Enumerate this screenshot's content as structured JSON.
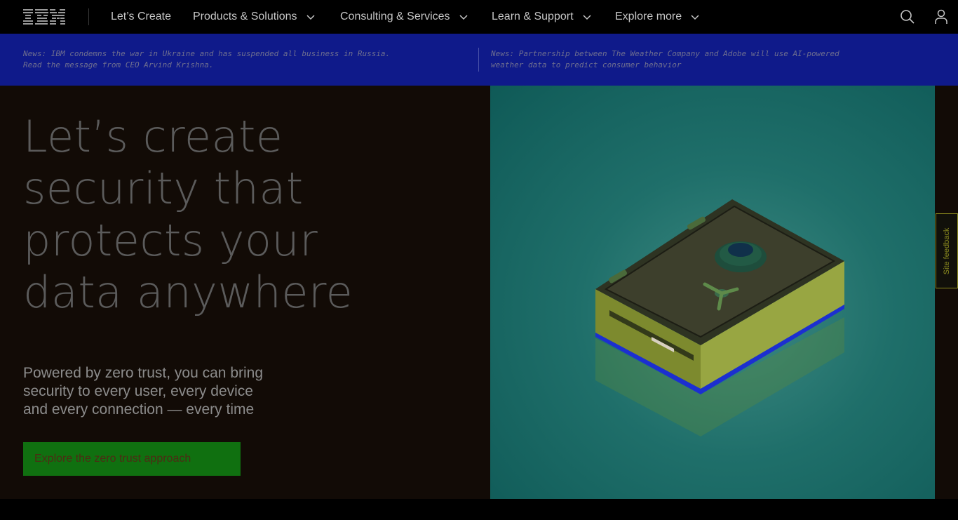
{
  "nav": {
    "logo": "IBM",
    "items": [
      {
        "label": "Let’s Create"
      },
      {
        "label": "Products & Solutions"
      },
      {
        "label": "Consulting & Services"
      },
      {
        "label": "Learn & Support"
      },
      {
        "label": "Explore more"
      }
    ],
    "icons": {
      "search": "search-icon",
      "user": "user-icon",
      "chevron": "chevron-down-icon"
    }
  },
  "news": {
    "left": {
      "line1": "News: IBM condemns the war in Ukraine and has suspended all business in Russia.",
      "line2": "Read the message from CEO Arvind Krishna."
    },
    "right": {
      "line1": "News: Partnership between The Weather Company and Adobe will use AI-powered",
      "line2": "weather data to predict consumer behavior"
    }
  },
  "hero": {
    "headline_lines": [
      "Let’s create",
      "security that",
      "protects your",
      "data anywhere"
    ],
    "subhead_lines": [
      "Powered by zero trust, you can bring",
      "security to every user, every device",
      "and every connection — every time"
    ],
    "cta_label": "Explore the zero trust approach",
    "image": "safe-illustration"
  },
  "feedback": {
    "label": "Site feedback"
  },
  "colors": {
    "nav_bg": "#000000",
    "news_bg": "#0f1a8a",
    "hero_bg": "#120b06",
    "cta_bg": "#107010",
    "art_bg": "#1f6f6a"
  }
}
